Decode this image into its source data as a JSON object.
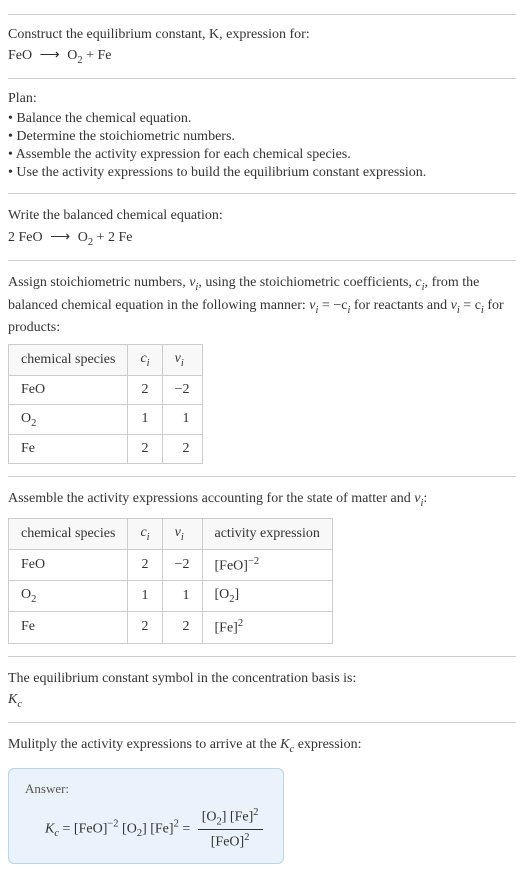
{
  "intro": {
    "line1": "Construct the equilibrium constant, K, expression for:",
    "equation_left": "FeO",
    "arrow": "⟶",
    "equation_right_o2": "O",
    "equation_right_o2_sub": "2",
    "equation_plus": " + Fe"
  },
  "plan": {
    "title": "Plan:",
    "items": [
      "• Balance the chemical equation.",
      "• Determine the stoichiometric numbers.",
      "• Assemble the activity expression for each chemical species.",
      "• Use the activity expressions to build the equilibrium constant expression."
    ]
  },
  "balanced": {
    "text": "Write the balanced chemical equation:",
    "left": "2 FeO",
    "arrow": "⟶",
    "o2": "O",
    "o2_sub": "2",
    "rest": " + 2 Fe"
  },
  "stoich": {
    "text_part1": "Assign stoichiometric numbers, ",
    "nu": "ν",
    "sub_i": "i",
    "text_part2": ", using the stoichiometric coefficients, ",
    "c": "c",
    "text_part3": ", from the balanced chemical equation in the following manner: ",
    "eq1_left": "ν",
    "eq1_right": " = −c",
    "text_part4": " for reactants and ",
    "eq2": " = c",
    "text_part5": " for products:",
    "headers": {
      "species": "chemical species",
      "ci": "c",
      "nui": "ν"
    },
    "rows": [
      {
        "species": "FeO",
        "ci": "2",
        "nui": "−2"
      },
      {
        "species_base": "O",
        "species_sub": "2",
        "ci": "1",
        "nui": "1"
      },
      {
        "species": "Fe",
        "ci": "2",
        "nui": "2"
      }
    ]
  },
  "activity": {
    "text_part1": "Assemble the activity expressions accounting for the state of matter and ",
    "nu": "ν",
    "sub_i": "i",
    "text_part2": ":",
    "headers": {
      "species": "chemical species",
      "ci": "c",
      "nui": "ν",
      "expr": "activity expression"
    },
    "rows": [
      {
        "species": "FeO",
        "ci": "2",
        "nui": "−2",
        "expr_base": "[FeO]",
        "expr_sup": "−2"
      },
      {
        "species_base": "O",
        "species_sub": "2",
        "ci": "1",
        "nui": "1",
        "expr_base": "[O",
        "expr_sub": "2",
        "expr_end": "]"
      },
      {
        "species": "Fe",
        "ci": "2",
        "nui": "2",
        "expr_base": "[Fe]",
        "expr_sup": "2"
      }
    ]
  },
  "kc_intro": {
    "text": "The equilibrium constant symbol in the concentration basis is:",
    "symbol_base": "K",
    "symbol_sub": "c"
  },
  "multiply": {
    "text_part1": "Mulitply the activity expressions to arrive at the ",
    "kc_base": "K",
    "kc_sub": "c",
    "text_part2": " expression:"
  },
  "answer": {
    "label": "Answer:",
    "kc_base": "K",
    "kc_sub": "c",
    "eq": " = ",
    "term1_base": "[FeO]",
    "term1_sup": "−2",
    "term2_base": " [O",
    "term2_sub": "2",
    "term2_end": "] ",
    "term3_base": "[Fe]",
    "term3_sup": "2",
    "eq2": " = ",
    "num_o2_base": "[O",
    "num_o2_sub": "2",
    "num_o2_end": "] ",
    "num_fe_base": "[Fe]",
    "num_fe_sup": "2",
    "den_base": "[FeO]",
    "den_sup": "2"
  }
}
